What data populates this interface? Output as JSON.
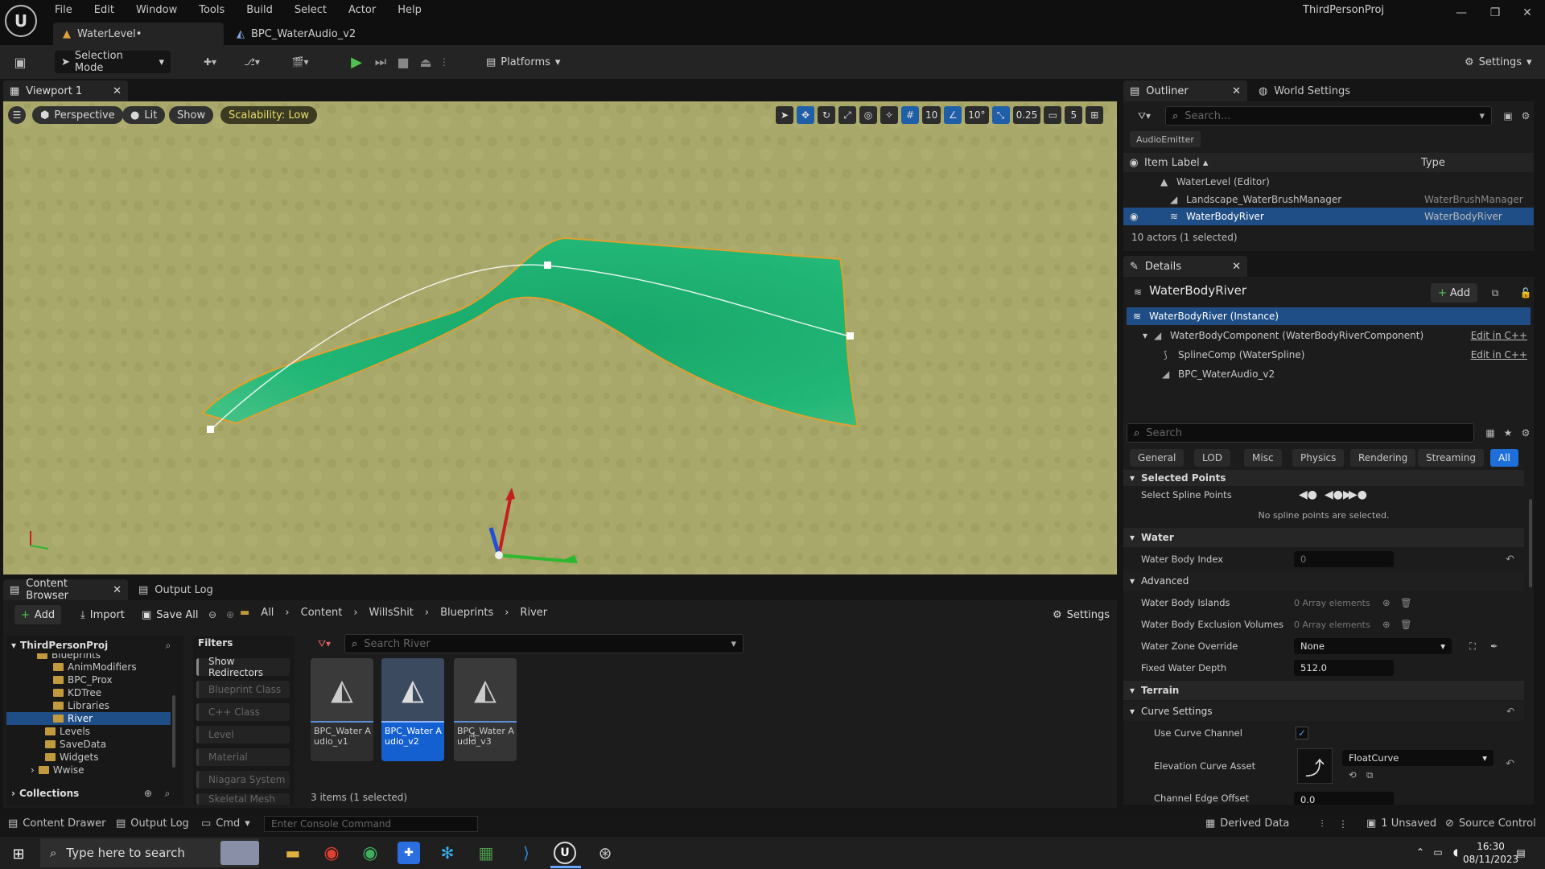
{
  "app": {
    "menu": [
      "File",
      "Edit",
      "Window",
      "Tools",
      "Build",
      "Select",
      "Actor",
      "Help"
    ],
    "project": "ThirdPersonProj"
  },
  "tabs": [
    {
      "label": "WaterLevel•"
    },
    {
      "label": "BPC_WaterAudio_v2"
    }
  ],
  "toolbar": {
    "selection_mode": "Selection Mode",
    "platforms": "Platforms",
    "settings": "Settings"
  },
  "viewport": {
    "tab": "Viewport 1",
    "perspective": "Perspective",
    "lit": "Lit",
    "show": "Show",
    "scalability": "Scalability: Low",
    "grid": "10",
    "angle": "10°",
    "scale": "0.25",
    "camera": "5"
  },
  "outliner": {
    "tab": "Outliner",
    "world_settings": "World Settings",
    "search_placeholder": "Search...",
    "chip": "AudioEmitter",
    "col_label": "Item Label ▴",
    "col_type": "Type",
    "rows": [
      {
        "label": "WaterLevel (Editor)",
        "type": ""
      },
      {
        "label": "Landscape_WaterBrushManager",
        "type": "WaterBrushManager"
      },
      {
        "label": "WaterBodyRiver",
        "type": "WaterBodyRiver"
      }
    ],
    "status": "10 actors (1 selected)"
  },
  "details": {
    "tab": "Details",
    "title": "WaterBodyRiver",
    "add": "Add",
    "components": [
      {
        "label": "WaterBodyRiver (Instance)",
        "link": ""
      },
      {
        "label": "WaterBodyComponent (WaterBodyRiverComponent)",
        "link": "Edit in C++"
      },
      {
        "label": "SplineComp (WaterSpline)",
        "link": "Edit in C++"
      },
      {
        "label": "BPC_WaterAudio_v2",
        "link": ""
      }
    ],
    "search_placeholder": "Search",
    "categories": [
      "General",
      "LOD",
      "Misc",
      "Physics",
      "Rendering",
      "Streaming",
      "All"
    ],
    "selected_points": "Selected Points",
    "select_spline_points": "Select Spline Points",
    "no_points": "No spline points are selected.",
    "water": "Water",
    "water_body_index": "Water Body Index",
    "water_body_index_val": "0",
    "advanced": "Advanced",
    "islands": "Water Body Islands",
    "islands_val": "0 Array elements",
    "exclusion": "Water Body Exclusion Volumes",
    "exclusion_val": "0 Array elements",
    "zone_override": "Water Zone Override",
    "zone_override_val": "None",
    "fixed_depth": "Fixed Water Depth",
    "fixed_depth_val": "512.0",
    "terrain": "Terrain",
    "curve_settings": "Curve Settings",
    "use_curve": "Use Curve Channel",
    "elevation_curve": "Elevation Curve Asset",
    "curve_type": "FloatCurve",
    "edge_offset": "Channel Edge Offset",
    "edge_offset_val": "0.0"
  },
  "content_browser": {
    "tab": "Content Browser",
    "output_log": "Output Log",
    "add": "Add",
    "import": "Import",
    "save_all": "Save All",
    "settings": "Settings",
    "crumbs": [
      "All",
      "Content",
      "WillsShit",
      "Blueprints",
      "River"
    ],
    "tree_root": "ThirdPersonProj",
    "tree": [
      "Blueprints",
      "AnimModifiers",
      "BPC_Prox",
      "KDTree",
      "Libraries",
      "River",
      "Levels",
      "SaveData",
      "Widgets",
      "Wwise"
    ],
    "collections": "Collections",
    "filters_title": "Filters",
    "filters": [
      "Show Redirectors",
      "Blueprint Class",
      "C++ Class",
      "Level",
      "Material",
      "Niagara System",
      "Skeletal Mesh"
    ],
    "search_placeholder": "Search River",
    "assets": [
      {
        "name": "BPC_Water Audio_v1"
      },
      {
        "name": "BPC_Water Audio_v2"
      },
      {
        "name": "BPC_Water Audio_v3"
      }
    ],
    "count": "3 items (1 selected)"
  },
  "status": {
    "content_drawer": "Content Drawer",
    "output_log": "Output Log",
    "cmd": "Cmd",
    "console_placeholder": "Enter Console Command",
    "derived": "Derived Data",
    "unsaved": "1 Unsaved",
    "source": "Source Control"
  },
  "taskbar": {
    "search": "Type here to search",
    "time": "16:30",
    "date": "08/11/2023"
  }
}
